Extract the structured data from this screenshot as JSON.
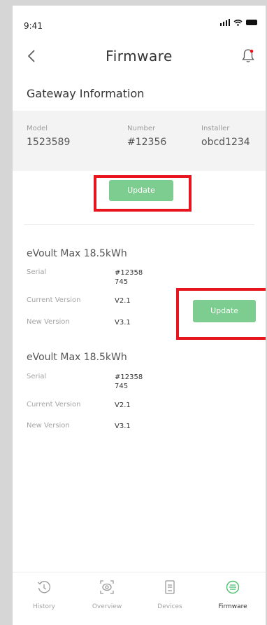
{
  "status": {
    "time": "9:41"
  },
  "header": {
    "title": "Firmware"
  },
  "gateway": {
    "section_title": "Gateway Information",
    "model_label": "Model",
    "model_value": "1523589",
    "number_label": "Number",
    "number_value": "#12356",
    "installer_label": "Installer",
    "installer_value": "obcd1234",
    "update_label": "Update"
  },
  "devices": [
    {
      "name": "eVoult Max 18.5kWh",
      "serial_label": "Serial",
      "serial_value_line1": "#12358",
      "serial_value_line2": "745",
      "current_label": "Current Version",
      "current_value": "V2.1",
      "new_label": "New Version",
      "new_value": "V3.1",
      "update_label": "Update"
    },
    {
      "name": "eVoult Max 18.5kWh",
      "serial_label": "Serial",
      "serial_value_line1": "#12358",
      "serial_value_line2": "745",
      "current_label": "Current Version",
      "current_value": "V2.1",
      "new_label": "New Version",
      "new_value": "V3.1"
    }
  ],
  "tabbar": {
    "items": [
      {
        "label": "History",
        "icon": "history-icon"
      },
      {
        "label": "Overview",
        "icon": "overview-icon"
      },
      {
        "label": "Devices",
        "icon": "devices-icon"
      },
      {
        "label": "Firmware",
        "icon": "firmware-icon",
        "active": true
      }
    ]
  },
  "colors": {
    "accent": "#7ccd8f",
    "highlight": "#e8141e"
  }
}
